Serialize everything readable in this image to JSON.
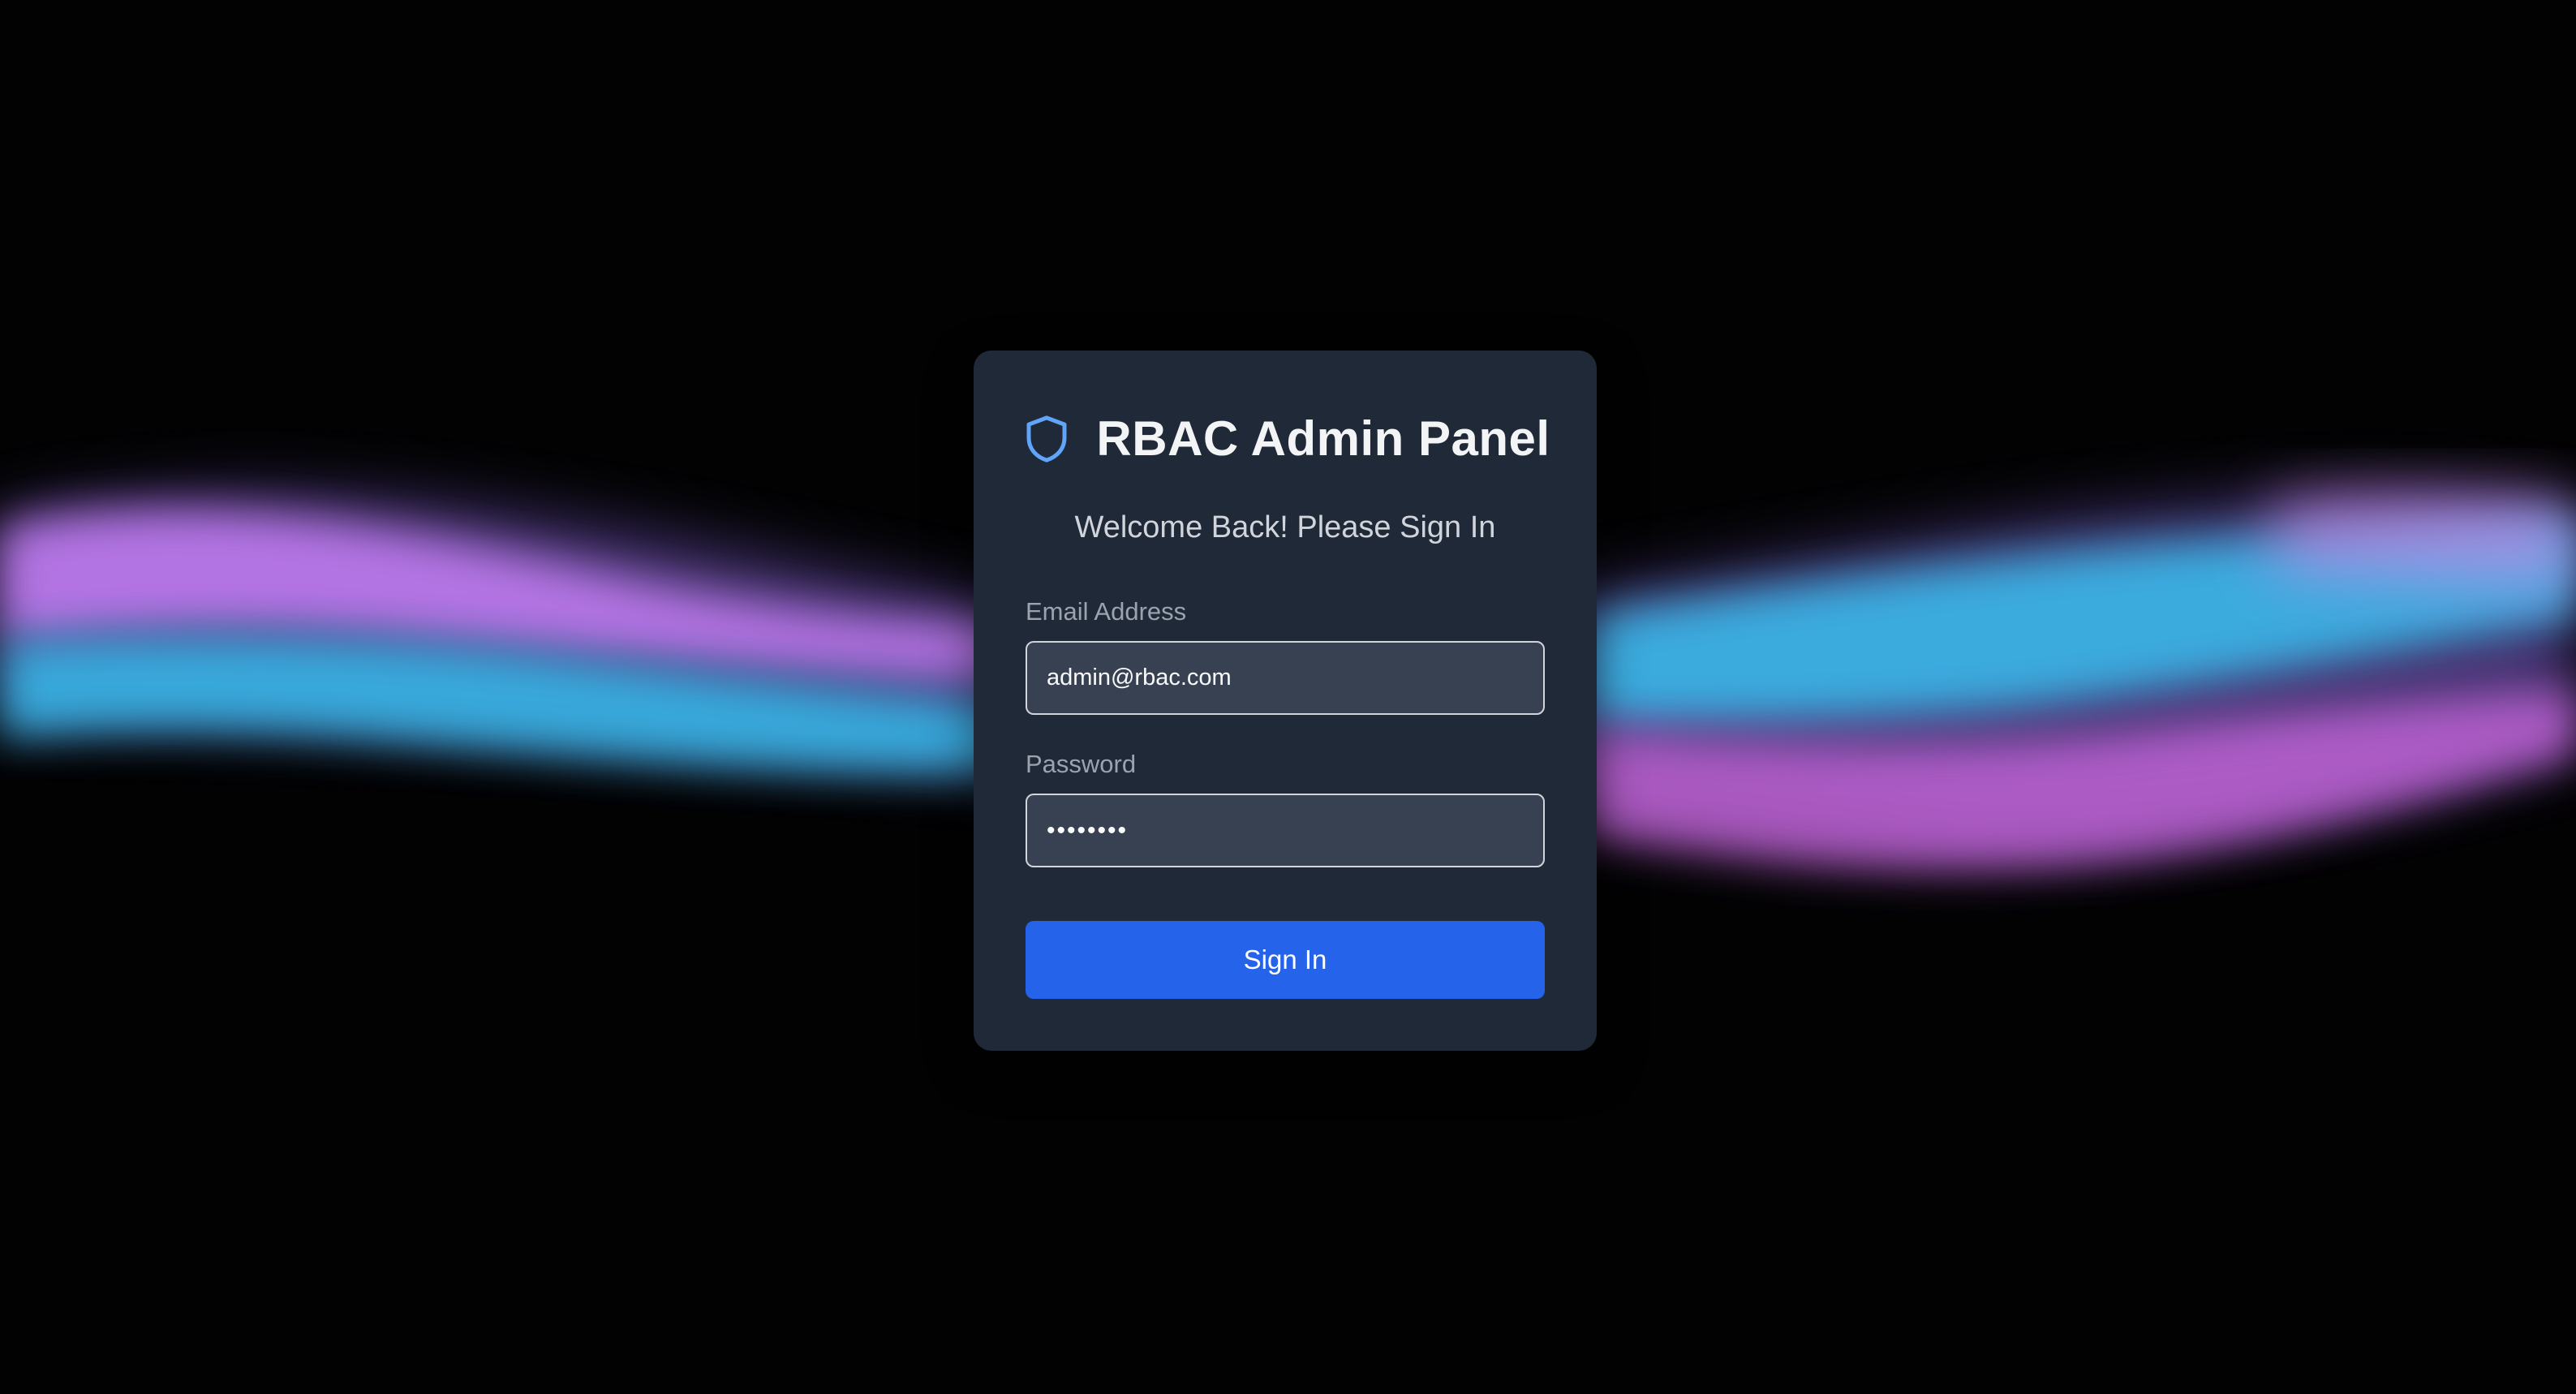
{
  "app": {
    "title": "RBAC Admin Panel",
    "icon": "shield-icon",
    "subtitle": "Welcome Back! Please Sign In"
  },
  "form": {
    "email": {
      "label": "Email Address",
      "value": "admin@rbac.com"
    },
    "password": {
      "label": "Password",
      "value": "••••••••"
    },
    "submit_label": "Sign In"
  },
  "colors": {
    "background": "#020203",
    "card": "#1f2937",
    "input_bg": "#374151",
    "accent": "#2563eb",
    "icon": "#60a5fa",
    "aurora_pink": "#c07cf0",
    "aurora_cyan": "#38bdf8"
  }
}
